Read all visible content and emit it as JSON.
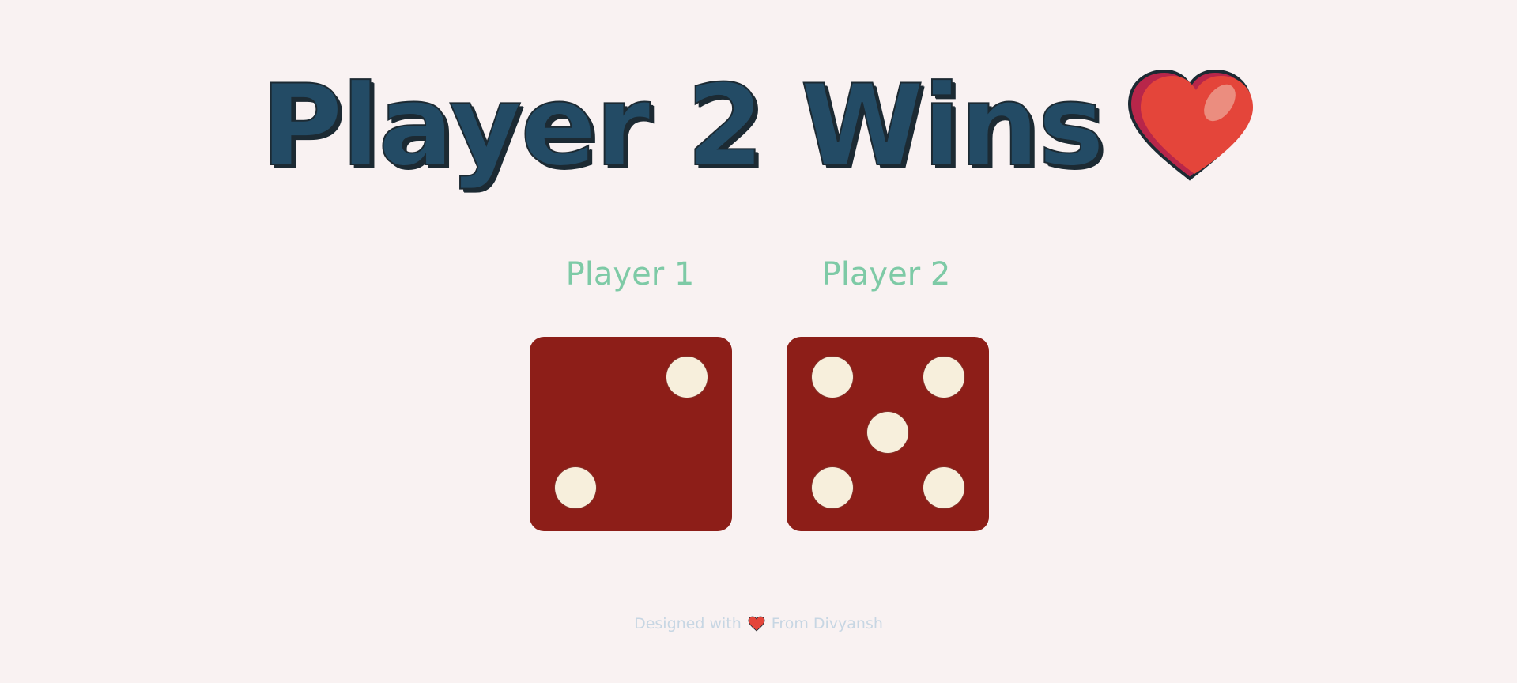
{
  "header": {
    "title": "Player 2 Wins",
    "heart_icon": "heart-icon"
  },
  "players": [
    {
      "label": "Player 1",
      "die_value": 2
    },
    {
      "label": "Player 2",
      "die_value": 5
    }
  ],
  "footer": {
    "prefix": "Designed with",
    "icon": "heart-icon",
    "suffix": "From Divyansh"
  },
  "colors": {
    "background": "#f9f2f2",
    "title": "#234b65",
    "player_label": "#7ecaa6",
    "die_face": "#8d1e18",
    "pip": "#f7efdc",
    "heart": "#e4453a"
  }
}
